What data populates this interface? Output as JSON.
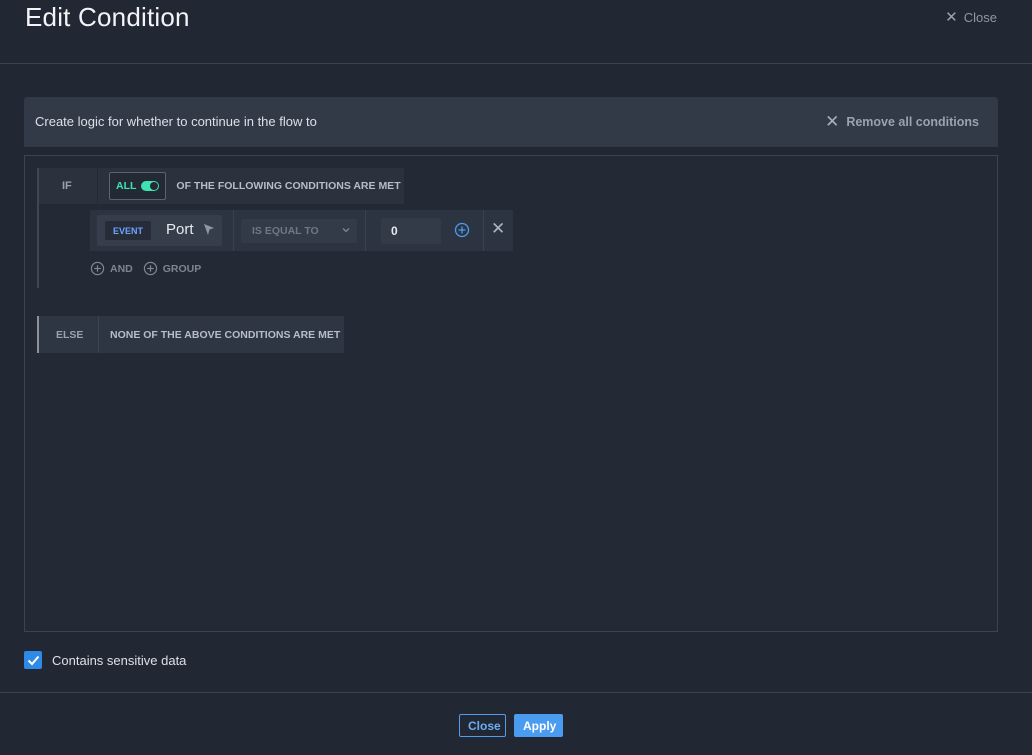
{
  "header": {
    "title": "Edit Condition",
    "close_label": "Close"
  },
  "builder": {
    "description": "Create logic for whether to continue in the flow to",
    "remove_all_label": "Remove all conditions",
    "if_label": "IF",
    "match_mode": "ALL",
    "match_mode_on": true,
    "conditions_text": "OF THE FOLLOWING CONDITIONS ARE MET",
    "rules": [
      {
        "source_badge": "EVENT",
        "field": "Port",
        "operator": "IS EQUAL TO",
        "value": "0"
      }
    ],
    "add_and_label": "AND",
    "add_group_label": "GROUP",
    "else_label": "ELSE",
    "else_text": "NONE OF THE ABOVE CONDITIONS ARE MET"
  },
  "sensitive": {
    "label": "Contains sensitive data",
    "checked": true
  },
  "footer": {
    "close_label": "Close",
    "apply_label": "Apply"
  },
  "colors": {
    "accent": "#4a9cf0",
    "toggle_on": "#3ee3b0",
    "event_badge": "#6ea2ff",
    "background": "#222833"
  }
}
